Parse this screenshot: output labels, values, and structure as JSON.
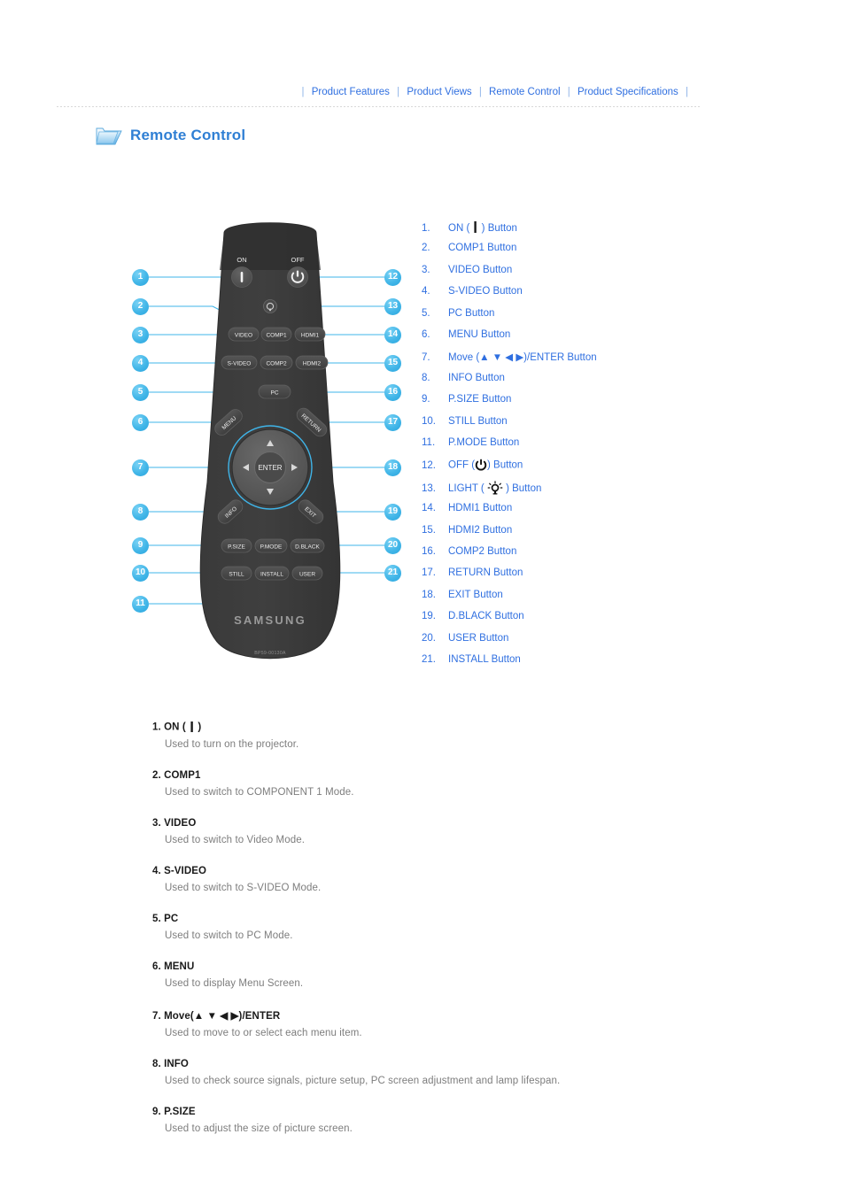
{
  "topnav": {
    "separator": "|",
    "items": [
      {
        "label": "Product Features"
      },
      {
        "label": "Product Views"
      },
      {
        "label": "Remote Control"
      },
      {
        "label": "Product Specifications"
      }
    ]
  },
  "page": {
    "title": "Remote Control",
    "title_color": "#2f7fd4",
    "link_color": "#2f6fe0"
  },
  "remote": {
    "brand": "SAMSUNG",
    "model_code": "BP59-00130A",
    "body_color": "#3b3b3b",
    "accent_color": "#3fb4e8",
    "labels": {
      "on": "ON",
      "off": "OFF",
      "video": "VIDEO",
      "comp1": "COMP1",
      "hdmi1": "HDMI1",
      "svideo": "S-VIDEO",
      "comp2": "COMP2",
      "hdmi2": "HDMI2",
      "pc": "PC",
      "menu": "MENU",
      "return": "RETURN",
      "enter": "ENTER",
      "info": "INFO",
      "exit": "EXIT",
      "psize": "P.SIZE",
      "pmode": "P.MODE",
      "dblack": "D.BLACK",
      "still": "STILL",
      "install": "INSTALL",
      "user": "USER"
    }
  },
  "callouts": [
    {
      "n": "1"
    },
    {
      "n": "2"
    },
    {
      "n": "3"
    },
    {
      "n": "4"
    },
    {
      "n": "5"
    },
    {
      "n": "6"
    },
    {
      "n": "7"
    },
    {
      "n": "8"
    },
    {
      "n": "9"
    },
    {
      "n": "10"
    },
    {
      "n": "11"
    },
    {
      "n": "12"
    },
    {
      "n": "13"
    },
    {
      "n": "14"
    },
    {
      "n": "15"
    },
    {
      "n": "16"
    },
    {
      "n": "17"
    },
    {
      "n": "18"
    },
    {
      "n": "19"
    },
    {
      "n": "20"
    },
    {
      "n": "21"
    }
  ],
  "button_list": [
    {
      "num": "1.",
      "label_pre": "ON ( ",
      "icon": "power-on-bar-icon",
      "label_post": " ) Button"
    },
    {
      "num": "2.",
      "label": "COMP1 Button"
    },
    {
      "num": "3.",
      "label": "VIDEO Button"
    },
    {
      "num": "4.",
      "label": "S-VIDEO Button"
    },
    {
      "num": "5.",
      "label": "PC Button"
    },
    {
      "num": "6.",
      "label": "MENU Button"
    },
    {
      "num": "7.",
      "label": "Move (▲ ▼ ◀ ▶)/ENTER Button"
    },
    {
      "num": "8.",
      "label": "INFO Button"
    },
    {
      "num": "9.",
      "label": "P.SIZE Button"
    },
    {
      "num": "10.",
      "label": "STILL Button"
    },
    {
      "num": "11.",
      "label": "P.MODE Button"
    },
    {
      "num": "12.",
      "label_pre": "OFF (",
      "icon": "power-icon",
      "label_post": ") Button"
    },
    {
      "num": "13.",
      "label_pre": "LIGHT ( ",
      "icon": "light-bulb-icon",
      "label_post": " ) Button"
    },
    {
      "num": "14.",
      "label": "HDMI1 Button"
    },
    {
      "num": "15.",
      "label": "HDMI2 Button"
    },
    {
      "num": "16.",
      "label": "COMP2 Button"
    },
    {
      "num": "17.",
      "label": "RETURN Button"
    },
    {
      "num": "18.",
      "label": "EXIT Button"
    },
    {
      "num": "19.",
      "label": "D.BLACK Button"
    },
    {
      "num": "20.",
      "label": "USER Button"
    },
    {
      "num": "21.",
      "label": "INSTALL Button"
    }
  ],
  "descriptions": [
    {
      "heading_pre": "1. ON ( ",
      "icon": "power-on-bar-icon",
      "heading_post": " )",
      "body": "Used to turn on the projector."
    },
    {
      "heading": "2. COMP1",
      "body": "Used to switch to COMPONENT 1 Mode."
    },
    {
      "heading": "3. VIDEO",
      "body": "Used to switch to Video Mode."
    },
    {
      "heading": "4. S-VIDEO",
      "body": "Used to switch to S-VIDEO Mode."
    },
    {
      "heading": "5. PC",
      "body": "Used to switch to PC Mode."
    },
    {
      "heading": "6. MENU",
      "body": "Used to display Menu Screen."
    },
    {
      "heading": "7. Move(▲ ▼ ◀ ▶)/ENTER",
      "body": "Used to move to or select each menu item."
    },
    {
      "heading": "8. INFO",
      "body": "Used to check source signals, picture setup, PC screen adjustment and lamp lifespan."
    },
    {
      "heading": "9. P.SIZE",
      "body": "Used to adjust the size of picture screen."
    }
  ]
}
